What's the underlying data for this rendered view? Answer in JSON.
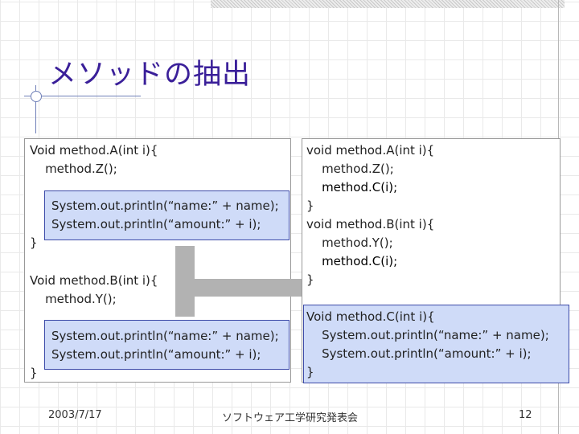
{
  "slide": {
    "title": "メソッドの抽出",
    "left_code": {
      "a_head": "Void method.A(int i){",
      "a_call": "    method.Z();",
      "a_print1": "System.out.println(“name:” + name);",
      "a_print2": "System.out.println(“amount:” + i);",
      "a_close": "}",
      "b_head": "Void method.B(int i){",
      "b_call": "    method.Y();",
      "b_print1": "System.out.println(“name:” + name);",
      "b_print2": "System.out.println(“amount:” + i);",
      "b_close": "}"
    },
    "right_code": {
      "a_head": "void method.A(int i){",
      "a_call": "    method.Z();",
      "a_newcall": "    method.C(i);",
      "a_close": "}",
      "b_head": "void method.B(int i){",
      "b_call": "    method.Y();",
      "b_newcall": "    method.C(i);",
      "b_close": "}",
      "c_head": "Void method.C(int i){",
      "c_print1": "    System.out.println(“name:” + name);",
      "c_print2": "    System.out.println(“amount:” + i);",
      "c_close": "}"
    },
    "footer": {
      "date": "2003/7/17",
      "org": "ソフトウェア工学研究発表会",
      "page": "12"
    }
  },
  "colors": {
    "title": "#3a1f99",
    "highlight_fill": "#cfdbf8",
    "highlight_border": "#3c4aa8",
    "arrow": "#b2b2b2"
  }
}
